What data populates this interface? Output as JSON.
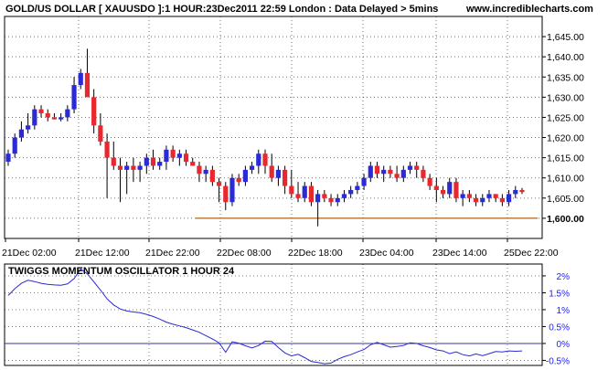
{
  "header": {
    "title": "GOLD/US DOLLAR [ XAUUSDO ]:1 HOUR:23Dec2011 22:59 London : Data Delayed > 5mins",
    "site": "www.incrediblecharts.com"
  },
  "colors": {
    "up": "#2b2bd6",
    "down": "#e8282f",
    "wick": "#000000",
    "support_line": "#b4651a",
    "oscillator": "#2a2ad0",
    "zero_line": "#3a3a9a",
    "grid": "#000000",
    "price_axis_text": "#000000",
    "osc_axis_text": "#1a1aff"
  },
  "chart_data": [
    {
      "type": "candlestick",
      "title": "GOLD/US DOLLAR [ XAUUSDO ]:1 HOUR:23Dec2011 22:59 London : Data Delayed > 5mins",
      "x_tick_labels": [
        "21Dec 02:00",
        "21Dec 12:00",
        "21Dec 22:00",
        "22Dec 08:00",
        "22Dec 18:00",
        "23Dec 04:00",
        "23Dec 14:00",
        "25Dec 22:00"
      ],
      "y_tick_labels": [
        "1,600.00",
        "1,605.00",
        "1,610.00",
        "1,615.00",
        "1,620.00",
        "1,625.00",
        "1,630.00",
        "1,635.00",
        "1,640.00",
        "1,645.00"
      ],
      "y_bold_tick": "1,600.00",
      "ylim": [
        1595,
        1650
      ],
      "grid": true,
      "candles": [
        {
          "o": 1614,
          "h": 1617,
          "l": 1613,
          "c": 1616
        },
        {
          "o": 1616,
          "h": 1621,
          "l": 1615,
          "c": 1620
        },
        {
          "o": 1620,
          "h": 1624,
          "l": 1619,
          "c": 1622
        },
        {
          "o": 1622,
          "h": 1626,
          "l": 1621,
          "c": 1623
        },
        {
          "o": 1623,
          "h": 1628,
          "l": 1622,
          "c": 1627
        },
        {
          "o": 1627,
          "h": 1628,
          "l": 1625,
          "c": 1626
        },
        {
          "o": 1626,
          "h": 1627,
          "l": 1624,
          "c": 1625
        },
        {
          "o": 1625,
          "h": 1626,
          "l": 1624.5,
          "c": 1624.5
        },
        {
          "o": 1624.5,
          "h": 1626,
          "l": 1624,
          "c": 1625
        },
        {
          "o": 1625,
          "h": 1628,
          "l": 1624,
          "c": 1627
        },
        {
          "o": 1627,
          "h": 1635,
          "l": 1626,
          "c": 1633
        },
        {
          "o": 1633,
          "h": 1637,
          "l": 1632,
          "c": 1636
        },
        {
          "o": 1636,
          "h": 1642,
          "l": 1632,
          "c": 1630
        },
        {
          "o": 1630,
          "h": 1632,
          "l": 1621,
          "c": 1623
        },
        {
          "o": 1623,
          "h": 1626,
          "l": 1618,
          "c": 1619
        },
        {
          "o": 1619,
          "h": 1621,
          "l": 1605,
          "c": 1615
        },
        {
          "o": 1615,
          "h": 1619,
          "l": 1612,
          "c": 1613
        },
        {
          "o": 1613,
          "h": 1615,
          "l": 1604,
          "c": 1612
        },
        {
          "o": 1612,
          "h": 1614,
          "l": 1606,
          "c": 1613
        },
        {
          "o": 1613,
          "h": 1615,
          "l": 1609,
          "c": 1612
        },
        {
          "o": 1612,
          "h": 1614,
          "l": 1609,
          "c": 1613
        },
        {
          "o": 1613,
          "h": 1616,
          "l": 1611,
          "c": 1615
        },
        {
          "o": 1615,
          "h": 1617,
          "l": 1612,
          "c": 1613
        },
        {
          "o": 1613,
          "h": 1615,
          "l": 1612,
          "c": 1614
        },
        {
          "o": 1614,
          "h": 1618,
          "l": 1612,
          "c": 1617
        },
        {
          "o": 1617,
          "h": 1618,
          "l": 1614,
          "c": 1615
        },
        {
          "o": 1615,
          "h": 1617,
          "l": 1613,
          "c": 1616
        },
        {
          "o": 1616,
          "h": 1617,
          "l": 1613,
          "c": 1614
        },
        {
          "o": 1614,
          "h": 1615,
          "l": 1613,
          "c": 1613
        },
        {
          "o": 1613,
          "h": 1614,
          "l": 1609,
          "c": 1611
        },
        {
          "o": 1611,
          "h": 1613,
          "l": 1609,
          "c": 1612
        },
        {
          "o": 1612,
          "h": 1613,
          "l": 1608,
          "c": 1609
        },
        {
          "o": 1609,
          "h": 1610,
          "l": 1604,
          "c": 1608
        },
        {
          "o": 1608,
          "h": 1609,
          "l": 1602,
          "c": 1604
        },
        {
          "o": 1604,
          "h": 1611,
          "l": 1603,
          "c": 1610
        },
        {
          "o": 1610,
          "h": 1611,
          "l": 1608,
          "c": 1609
        },
        {
          "o": 1609,
          "h": 1613,
          "l": 1608,
          "c": 1612
        },
        {
          "o": 1612,
          "h": 1614,
          "l": 1611,
          "c": 1613
        },
        {
          "o": 1613,
          "h": 1617,
          "l": 1611,
          "c": 1616
        },
        {
          "o": 1616,
          "h": 1617,
          "l": 1611,
          "c": 1613
        },
        {
          "o": 1613,
          "h": 1616,
          "l": 1609,
          "c": 1610
        },
        {
          "o": 1610,
          "h": 1613,
          "l": 1608,
          "c": 1612
        },
        {
          "o": 1612,
          "h": 1613,
          "l": 1606,
          "c": 1608
        },
        {
          "o": 1608,
          "h": 1612,
          "l": 1605,
          "c": 1606
        },
        {
          "o": 1606,
          "h": 1609,
          "l": 1604,
          "c": 1605
        },
        {
          "o": 1605,
          "h": 1609,
          "l": 1604,
          "c": 1608
        },
        {
          "o": 1608,
          "h": 1609,
          "l": 1603,
          "c": 1604
        },
        {
          "o": 1604,
          "h": 1607,
          "l": 1598,
          "c": 1606
        },
        {
          "o": 1606,
          "h": 1607,
          "l": 1604,
          "c": 1605
        },
        {
          "o": 1605,
          "h": 1606,
          "l": 1603,
          "c": 1604
        },
        {
          "o": 1604,
          "h": 1606,
          "l": 1603,
          "c": 1605
        },
        {
          "o": 1605,
          "h": 1607,
          "l": 1604,
          "c": 1606
        },
        {
          "o": 1606,
          "h": 1608,
          "l": 1605,
          "c": 1607
        },
        {
          "o": 1607,
          "h": 1609,
          "l": 1606,
          "c": 1608
        },
        {
          "o": 1608,
          "h": 1611,
          "l": 1607,
          "c": 1610
        },
        {
          "o": 1610,
          "h": 1614,
          "l": 1609,
          "c": 1613
        },
        {
          "o": 1613,
          "h": 1614,
          "l": 1610,
          "c": 1611
        },
        {
          "o": 1611,
          "h": 1613,
          "l": 1609,
          "c": 1612
        },
        {
          "o": 1612,
          "h": 1613,
          "l": 1610,
          "c": 1611
        },
        {
          "o": 1611,
          "h": 1613,
          "l": 1609,
          "c": 1610
        },
        {
          "o": 1610,
          "h": 1613,
          "l": 1609,
          "c": 1612
        },
        {
          "o": 1612,
          "h": 1614,
          "l": 1611,
          "c": 1613
        },
        {
          "o": 1613,
          "h": 1614,
          "l": 1610,
          "c": 1612
        },
        {
          "o": 1612,
          "h": 1613,
          "l": 1609,
          "c": 1610
        },
        {
          "o": 1610,
          "h": 1611,
          "l": 1607,
          "c": 1608
        },
        {
          "o": 1608,
          "h": 1610,
          "l": 1604,
          "c": 1607
        },
        {
          "o": 1607,
          "h": 1608,
          "l": 1605,
          "c": 1606
        },
        {
          "o": 1606,
          "h": 1610,
          "l": 1605,
          "c": 1609
        },
        {
          "o": 1609,
          "h": 1610,
          "l": 1604,
          "c": 1605
        },
        {
          "o": 1605,
          "h": 1607,
          "l": 1603,
          "c": 1606
        },
        {
          "o": 1606,
          "h": 1607,
          "l": 1604,
          "c": 1605
        },
        {
          "o": 1605,
          "h": 1606,
          "l": 1603,
          "c": 1604
        },
        {
          "o": 1604,
          "h": 1606,
          "l": 1603,
          "c": 1605
        },
        {
          "o": 1605,
          "h": 1607,
          "l": 1604,
          "c": 1606
        },
        {
          "o": 1606,
          "h": 1606,
          "l": 1604,
          "c": 1605
        },
        {
          "o": 1605,
          "h": 1606,
          "l": 1603,
          "c": 1604
        },
        {
          "o": 1604,
          "h": 1607,
          "l": 1603,
          "c": 1606
        },
        {
          "o": 1606,
          "h": 1608,
          "l": 1605,
          "c": 1607
        },
        {
          "o": 1607,
          "h": 1607.5,
          "l": 1606,
          "c": 1606.5
        }
      ],
      "support_level": 1600,
      "support_start_index": 29
    },
    {
      "type": "line",
      "title": "TWIGGS MOMENTUM OSCILLATOR 1 HOUR 24",
      "y_tick_labels": [
        "2%",
        "1.5%",
        "1%",
        "0.5%",
        "0%",
        "-0.5%"
      ],
      "ylim": [
        -0.65,
        2.35
      ],
      "zero_line": 0,
      "grid": true,
      "values": [
        1.42,
        1.62,
        1.78,
        1.87,
        1.83,
        1.78,
        1.75,
        1.73,
        1.72,
        1.76,
        1.92,
        2.2,
        2.06,
        1.82,
        1.58,
        1.32,
        1.14,
        1.02,
        0.96,
        0.93,
        0.91,
        0.86,
        0.8,
        0.72,
        0.63,
        0.57,
        0.52,
        0.47,
        0.4,
        0.33,
        0.23,
        0.13,
        0.02,
        -0.26,
        0.05,
        0.01,
        -0.07,
        -0.13,
        -0.06,
        0.07,
        0.06,
        -0.12,
        -0.28,
        -0.37,
        -0.32,
        -0.42,
        -0.53,
        -0.56,
        -0.6,
        -0.58,
        -0.47,
        -0.39,
        -0.33,
        -0.25,
        -0.18,
        -0.04,
        0.03,
        -0.04,
        -0.11,
        -0.09,
        -0.06,
        0.02,
        0.0,
        -0.07,
        -0.12,
        -0.19,
        -0.22,
        -0.3,
        -0.25,
        -0.33,
        -0.37,
        -0.31,
        -0.36,
        -0.3,
        -0.24,
        -0.25,
        -0.22,
        -0.23,
        -0.22
      ]
    }
  ]
}
